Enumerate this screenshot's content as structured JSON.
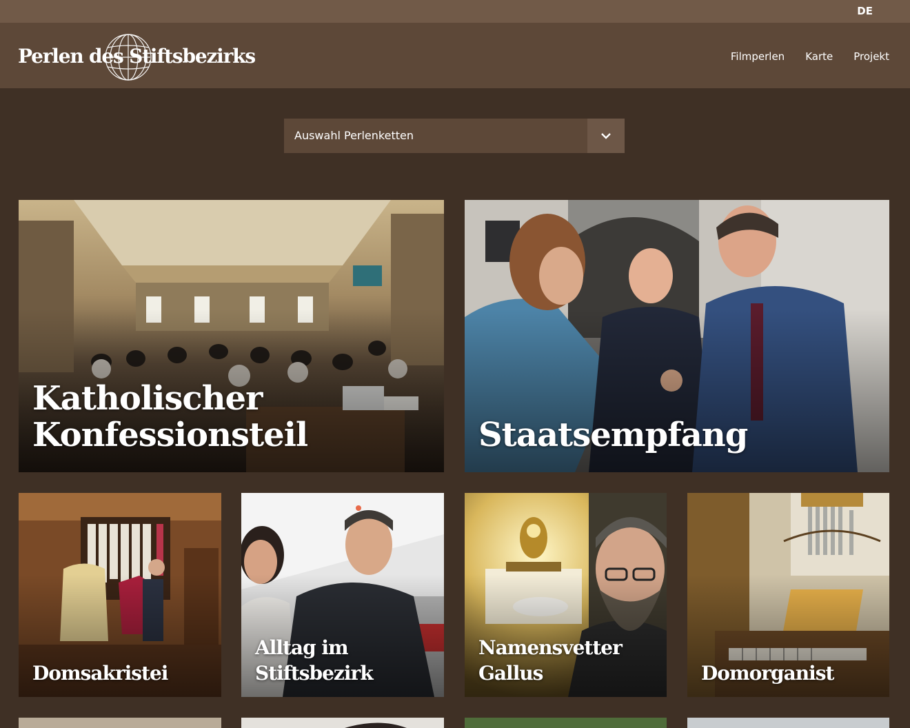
{
  "lang": "DE",
  "logo": {
    "text": "Perlen des Stiftsbezirks"
  },
  "nav": {
    "items": [
      "Filmperlen",
      "Karte",
      "Projekt"
    ]
  },
  "select": {
    "label": "Auswahl Perlenketten"
  },
  "cards": {
    "featured": [
      {
        "title_line1": "Katholischer",
        "title_line2": "Konfessionsteil"
      },
      {
        "title": "Staatsempfang"
      }
    ],
    "small": [
      {
        "title": "Domsakristei"
      },
      {
        "title_line1": "Alltag im",
        "title_line2": "Stiftsbezirk"
      },
      {
        "title_line1": "Namensvetter",
        "title_line2": "Gallus"
      },
      {
        "title": "Domorganist"
      }
    ]
  },
  "colors": {
    "page_bg": "#3f3025",
    "header_bg": "#5d4838",
    "topbar_bg": "#715a48"
  }
}
